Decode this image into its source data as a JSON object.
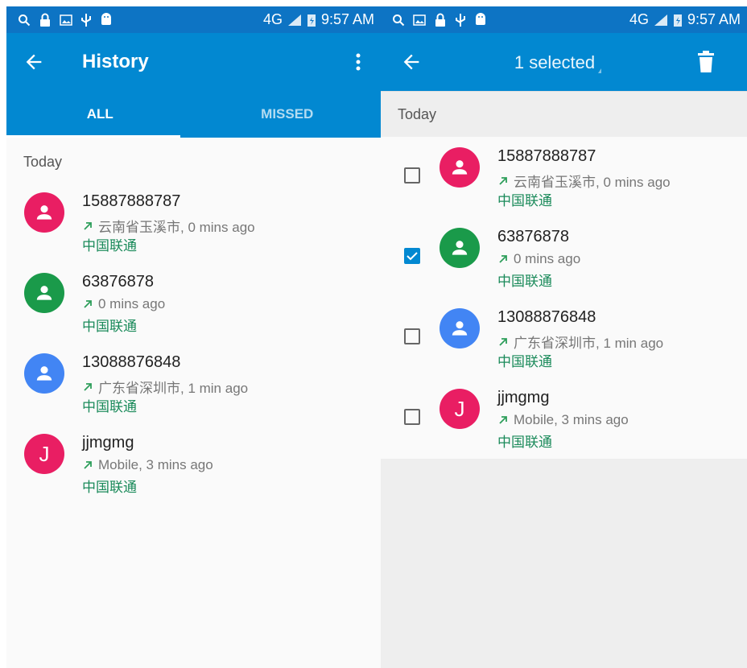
{
  "status_bar": {
    "network": "4G",
    "time": "9:57 AM"
  },
  "left": {
    "appbar": {
      "title": "History"
    },
    "tabs": [
      {
        "label": "ALL",
        "active": true
      },
      {
        "label": "MISSED",
        "active": false
      }
    ],
    "section": "Today",
    "calls": [
      {
        "name": "15887888787",
        "detail": "云南省玉溪市, 0 mins ago",
        "carrier": "中国联通",
        "avatar_color": "#e91e63",
        "avatar_letter": ""
      },
      {
        "name": "63876878",
        "detail": "0 mins ago",
        "carrier": "中国联通",
        "avatar_color": "#1a9a4a",
        "avatar_letter": ""
      },
      {
        "name": "13088876848",
        "detail": "广东省深圳市, 1 min ago",
        "carrier": "中国联通",
        "avatar_color": "#4285f4",
        "avatar_letter": ""
      },
      {
        "name": "jjmgmg",
        "detail": "Mobile, 3 mins ago",
        "carrier": "中国联通",
        "avatar_color": "#e91e63",
        "avatar_letter": "J"
      }
    ]
  },
  "right": {
    "appbar": {
      "title": "1 selected"
    },
    "section": "Today",
    "calls": [
      {
        "name": "15887888787",
        "detail": "云南省玉溪市, 0 mins ago",
        "carrier": "中国联通",
        "avatar_color": "#e91e63",
        "avatar_letter": "",
        "checked": false
      },
      {
        "name": "63876878",
        "detail": "0 mins ago",
        "carrier": "中国联通",
        "avatar_color": "#1a9a4a",
        "avatar_letter": "",
        "checked": true
      },
      {
        "name": "13088876848",
        "detail": "广东省深圳市, 1 min ago",
        "carrier": "中国联通",
        "avatar_color": "#4285f4",
        "avatar_letter": "",
        "checked": false
      },
      {
        "name": "jjmgmg",
        "detail": "Mobile, 3 mins ago",
        "carrier": "中国联通",
        "avatar_color": "#e91e63",
        "avatar_letter": "J",
        "checked": false
      }
    ]
  },
  "colors": {
    "status_bar": "#0d74c4",
    "app_bar": "#0288d1",
    "outgoing_arrow": "#2e9e5b",
    "carrier_text": "#1a8a5a"
  },
  "icons": [
    "search-icon",
    "lock-icon",
    "image-icon",
    "usb-icon",
    "android-icon",
    "signal-icon",
    "battery-icon",
    "back-arrow-icon",
    "more-vert-icon",
    "trash-icon",
    "person-icon",
    "outgoing-call-icon",
    "check-icon"
  ]
}
